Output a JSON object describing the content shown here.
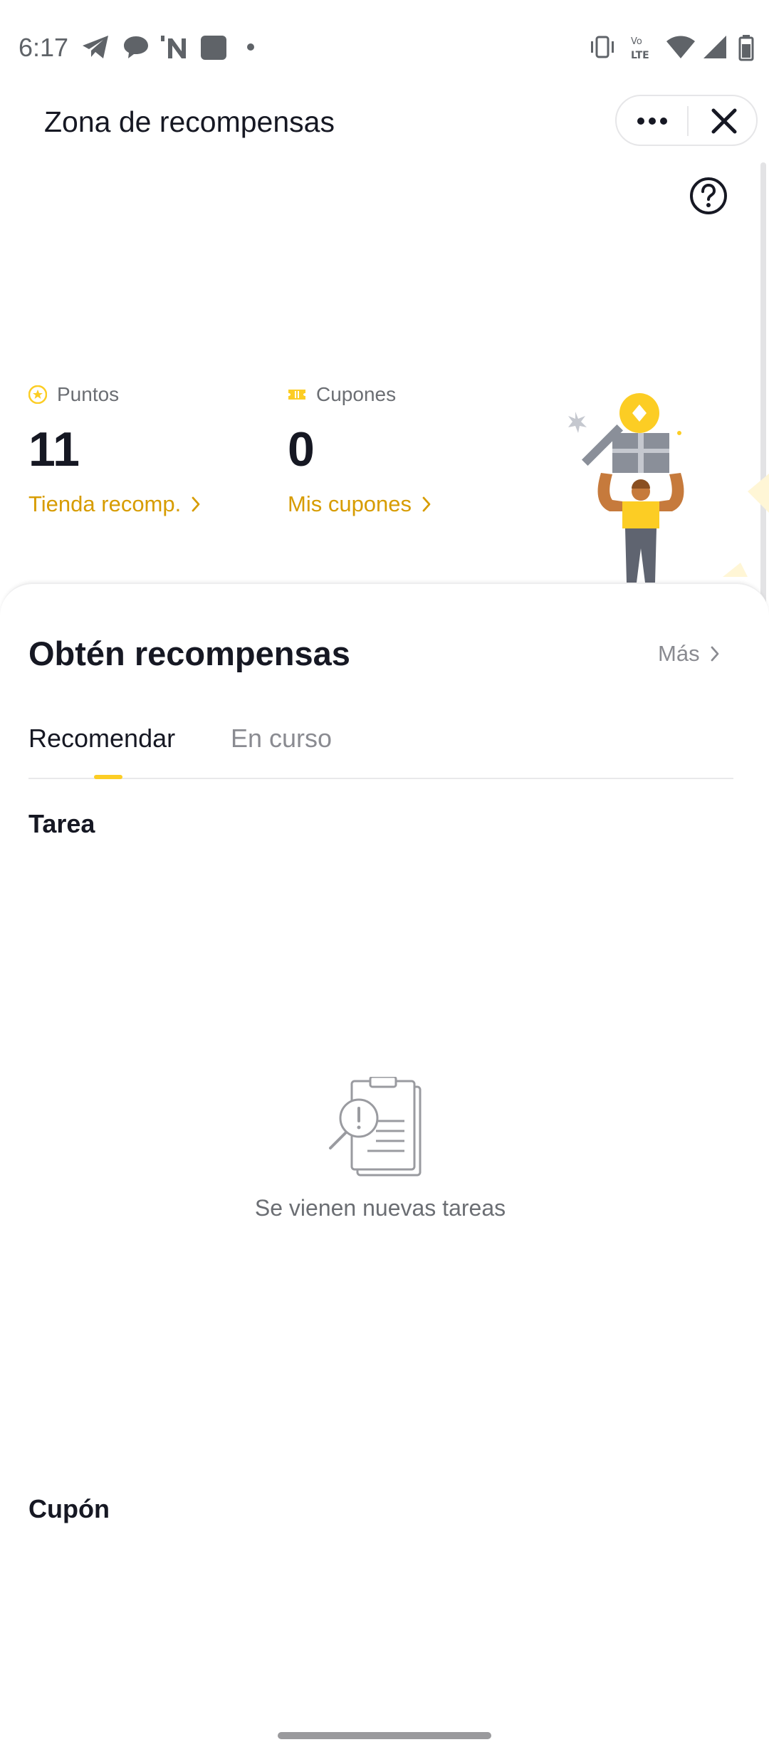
{
  "status_bar": {
    "time": "6:17",
    "left_icons": [
      "telegram-icon",
      "chat-bubble-icon",
      "n-app-icon",
      "app-square-icon",
      "dot-icon"
    ],
    "right_icons": [
      "vibrate-icon",
      "volte-icon",
      "wifi-icon",
      "signal-icon",
      "battery-icon"
    ]
  },
  "header": {
    "title": "Zona de recompensas",
    "more_icon": "more-icon",
    "close_icon": "close-icon"
  },
  "help_icon": "help-icon",
  "summary": {
    "points": {
      "label": "Puntos",
      "value": "11",
      "link": "Tienda recomp."
    },
    "coupons": {
      "label": "Cupones",
      "value": "0",
      "link": "Mis cupones"
    }
  },
  "rewards": {
    "title": "Obtén recompensas",
    "more": "Más",
    "tabs": [
      {
        "label": "Recomendar",
        "active": true
      },
      {
        "label": "En curso",
        "active": false
      }
    ],
    "task_section": "Tarea",
    "empty_text": "Se vienen nuevas tareas",
    "coupon_section": "Cupón"
  },
  "colors": {
    "accent": "#d79c00",
    "tab_indicator": "#fccd24",
    "text_primary": "#161823",
    "text_secondary": "#8a8b91"
  }
}
